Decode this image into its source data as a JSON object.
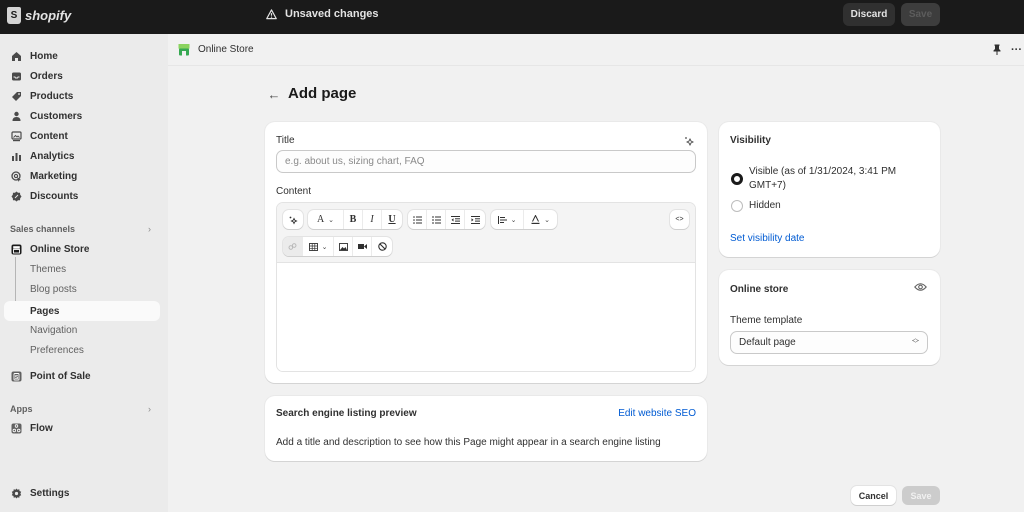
{
  "topbar": {
    "brand": "shopify",
    "status": "Unsaved changes",
    "discard_label": "Discard",
    "save_label": "Save"
  },
  "sidebar": {
    "items": [
      {
        "label": "Home",
        "icon": "home-icon"
      },
      {
        "label": "Orders",
        "icon": "orders-icon"
      },
      {
        "label": "Products",
        "icon": "tag-icon"
      },
      {
        "label": "Customers",
        "icon": "person-icon"
      },
      {
        "label": "Content",
        "icon": "content-icon"
      },
      {
        "label": "Analytics",
        "icon": "bar-chart-icon"
      },
      {
        "label": "Marketing",
        "icon": "target-icon"
      },
      {
        "label": "Discounts",
        "icon": "discount-icon"
      }
    ],
    "sales_channels_heading": "Sales channels",
    "online_store": {
      "label": "Online Store",
      "subitems": [
        "Themes",
        "Blog posts",
        "Pages",
        "Navigation",
        "Preferences"
      ],
      "active": "Pages"
    },
    "point_of_sale": "Point of Sale",
    "apps_heading": "Apps",
    "flow": "Flow",
    "settings": "Settings"
  },
  "channel_bar": {
    "title": "Online Store"
  },
  "page": {
    "title": "Add page",
    "title_field": {
      "label": "Title",
      "value": "",
      "placeholder": "e.g. about us, sizing chart, FAQ"
    },
    "content_label": "Content",
    "toolbar": {
      "font_label": "A",
      "bold": "B",
      "italic": "I",
      "underline": "U",
      "html_toggle": "<>"
    },
    "seo": {
      "title": "Search engine listing preview",
      "link": "Edit website SEO",
      "description": "Add a title and description to see how this Page might appear in a search engine listing"
    },
    "visibility": {
      "title": "Visibility",
      "options": [
        {
          "label_line1": "Visible (as of 1/31/2024, 3:41 PM",
          "label_line2": "GMT+7)",
          "selected": true
        },
        {
          "label_line1": "Hidden",
          "label_line2": "",
          "selected": false
        }
      ],
      "link": "Set visibility date"
    },
    "online_store_card": {
      "title": "Online store",
      "template_label": "Theme template",
      "template_value": "Default page"
    },
    "cancel_label": "Cancel",
    "save_label": "Save"
  },
  "colors": {
    "link": "#005bd3",
    "topbar_bg": "#1a1a1a",
    "store_icon": "#36a852"
  }
}
